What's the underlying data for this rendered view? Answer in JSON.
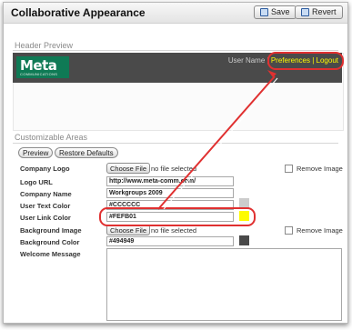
{
  "window": {
    "title": "Collaborative Appearance",
    "save_label": "Save",
    "revert_label": "Revert"
  },
  "header_preview": {
    "section_label": "Header Preview",
    "logo_text": "Meta",
    "logo_subtext": "COMMUNICATIONS",
    "user_name": "User Name",
    "separator": "|",
    "preferences_link": "Preferences",
    "link_separator": "|",
    "logout_link": "Logout"
  },
  "customizable": {
    "section_label": "Customizable Areas",
    "preview_button": "Preview",
    "restore_button": "Restore Defaults",
    "fields": [
      {
        "label": "Company Logo",
        "type": "file",
        "button": "Choose File",
        "status": "no file selected",
        "remove_label": "Remove Image"
      },
      {
        "label": "Logo URL",
        "type": "text",
        "value": "http://www.meta-comm.com/"
      },
      {
        "label": "Company Name",
        "type": "text",
        "value": "Workgroups 2009"
      },
      {
        "label": "User Text Color",
        "type": "color",
        "value": "#CCCCCC",
        "swatch": "#CCCCCC"
      },
      {
        "label": "User Link Color",
        "type": "color",
        "value": "#FEFB01",
        "swatch": "#FEFB01"
      },
      {
        "label": "Background Image",
        "type": "file",
        "button": "Choose File",
        "status": "no file selected",
        "remove_label": "Remove Image"
      },
      {
        "label": "Background Color",
        "type": "color",
        "value": "#494949",
        "swatch": "#494949"
      },
      {
        "label": "Welcome Message",
        "type": "textarea",
        "value": ""
      }
    ]
  },
  "colors": {
    "highlight": "#e03030",
    "header_bg": "#4a4a4a",
    "link_color": "#fefb01",
    "logo_bg": "#0f7a55"
  },
  "icons": {
    "save": "disk-icon",
    "revert": "revert-icon"
  }
}
